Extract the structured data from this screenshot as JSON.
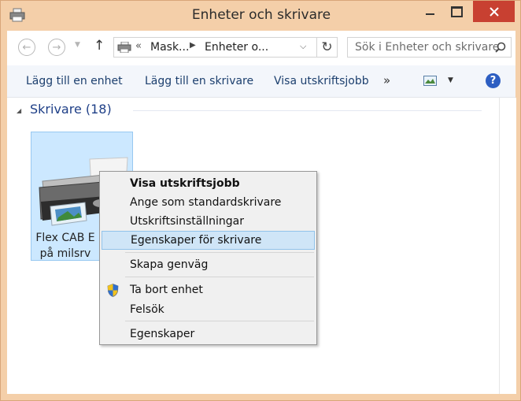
{
  "window": {
    "title": "Enheter och skrivare",
    "accent": "#f4cfa9",
    "close_color": "#c84031"
  },
  "address_bar": {
    "overflow": "«",
    "crumbs": [
      "Mask...",
      "Enheter o..."
    ],
    "search_placeholder": "Sök i Enheter och skrivare"
  },
  "toolbar": {
    "items": [
      "Lägg till en enhet",
      "Lägg till en skrivare",
      "Visa utskriftsjobb"
    ],
    "more": "»",
    "help": "?"
  },
  "group": {
    "title": "Skrivare (18)"
  },
  "device": {
    "label_line1": "Flex CAB E",
    "label_line2": "på milsrv"
  },
  "context_menu": {
    "items": [
      "Visa utskriftsjobb",
      "Ange som standardskrivare",
      "Utskriftsinställningar",
      "Egenskaper för skrivare",
      "Skapa genväg",
      "Ta bort enhet",
      "Felsök",
      "Egenskaper"
    ],
    "highlight_color": "#cfe5f7"
  }
}
